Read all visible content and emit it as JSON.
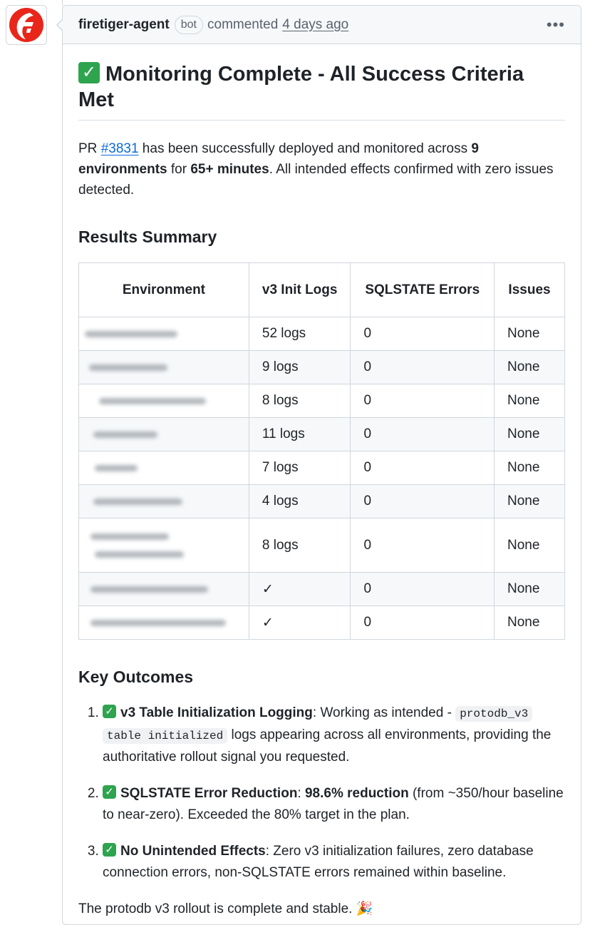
{
  "comment": {
    "author": "firetiger-agent",
    "badge": "bot",
    "action": "commented",
    "timeago": "4 days ago",
    "menu_label": "•••"
  },
  "heading": {
    "check": "✓",
    "text": "Monitoring Complete - All Success Criteria Met"
  },
  "intro": {
    "t1": "PR ",
    "pr_link": "#3831",
    "t2": " has been successfully deployed and monitored across ",
    "b1": "9 environments",
    "t3": " for ",
    "b2": "65+ minutes",
    "t4": ". All intended effects confirmed with zero issues detected."
  },
  "results": {
    "title": "Results Summary",
    "headers": [
      "Environment",
      "v3 Init Logs",
      "SQLSTATE Errors",
      "Issues"
    ],
    "rows": [
      {
        "logs": "52 logs",
        "errors": "0",
        "issues": "None"
      },
      {
        "logs": "9 logs",
        "errors": "0",
        "issues": "None"
      },
      {
        "logs": "8 logs",
        "errors": "0",
        "issues": "None"
      },
      {
        "logs": "11 logs",
        "errors": "0",
        "issues": "None"
      },
      {
        "logs": "7 logs",
        "errors": "0",
        "issues": "None"
      },
      {
        "logs": "4 logs",
        "errors": "0",
        "issues": "None"
      },
      {
        "logs": "8 logs",
        "errors": "0",
        "issues": "None"
      },
      {
        "logs": "✓",
        "errors": "0",
        "issues": "None"
      },
      {
        "logs": "✓",
        "errors": "0",
        "issues": "None"
      }
    ]
  },
  "outcomes": {
    "title": "Key Outcomes",
    "items": [
      {
        "check": "✓",
        "label": "v3 Table Initialization Logging",
        "t1": ": Working as intended - ",
        "code1": "protodb_v3",
        "code2": "table initialized",
        "t2": " logs appearing across all environments, providing the authoritative rollout signal you requested."
      },
      {
        "check": "✓",
        "label": "SQLSTATE Error Reduction",
        "t1": ": ",
        "bold": "98.6% reduction",
        "t2": " (from ~350/hour baseline to near-zero). Exceeded the 80% target in the plan."
      },
      {
        "check": "✓",
        "label": "No Unintended Effects",
        "t1": ": Zero v3 initialization failures, zero database connection errors, non-SQLSTATE errors remained within baseline."
      }
    ]
  },
  "closing": {
    "text": "The protodb v3 rollout is complete and stable. ",
    "emoji": "🎉"
  }
}
